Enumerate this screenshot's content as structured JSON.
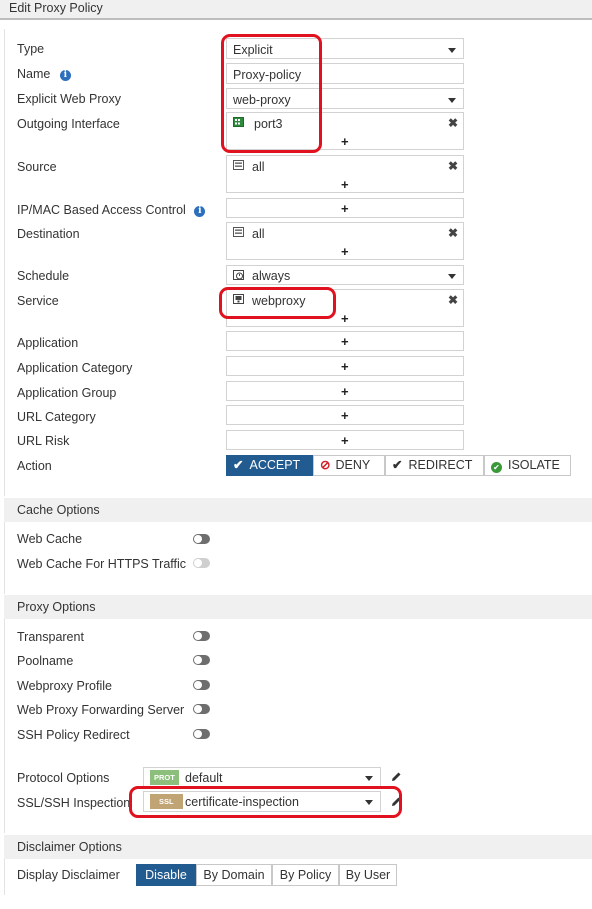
{
  "window": {
    "title": "Edit Proxy Policy"
  },
  "fields": {
    "type": {
      "label": "Type",
      "value": "Explicit"
    },
    "name": {
      "label": "Name",
      "value": "Proxy-policy"
    },
    "explicit_web_proxy": {
      "label": "Explicit Web Proxy",
      "value": "web-proxy"
    },
    "outgoing_interface": {
      "label": "Outgoing Interface",
      "value": "port3"
    },
    "source": {
      "label": "Source",
      "value": "all"
    },
    "ip_mac": {
      "label": "IP/MAC Based Access Control"
    },
    "destination": {
      "label": "Destination",
      "value": "all"
    },
    "schedule": {
      "label": "Schedule",
      "value": "always"
    },
    "service": {
      "label": "Service",
      "value": "webproxy"
    },
    "application": {
      "label": "Application"
    },
    "application_category": {
      "label": "Application Category"
    },
    "application_group": {
      "label": "Application Group"
    },
    "url_category": {
      "label": "URL Category"
    },
    "url_risk": {
      "label": "URL Risk"
    },
    "action": {
      "label": "Action",
      "options": [
        "ACCEPT",
        "DENY",
        "REDIRECT",
        "ISOLATE"
      ],
      "selected": "ACCEPT"
    }
  },
  "cache_options": {
    "header": "Cache Options",
    "web_cache": "Web Cache",
    "web_cache_https": "Web Cache For HTTPS Traffic"
  },
  "proxy_options": {
    "header": "Proxy Options",
    "transparent": "Transparent",
    "poolname": "Poolname",
    "webproxy_profile": "Webproxy Profile",
    "forwarding_server": "Web Proxy Forwarding Server",
    "ssh_redirect": "SSH Policy Redirect",
    "protocol_options": {
      "label": "Protocol Options",
      "badge": "PROT",
      "value": "default"
    },
    "ssl_ssh": {
      "label": "SSL/SSH Inspection",
      "badge": "SSL",
      "value": "certificate-inspection"
    }
  },
  "disclaimer": {
    "header": "Disclaimer Options",
    "label": "Display Disclaimer",
    "options": [
      "Disable",
      "By Domain",
      "By Policy",
      "By User"
    ],
    "selected": "Disable"
  },
  "icons": {
    "plus": "+",
    "remove": "✖"
  },
  "colors": {
    "accent": "#225b8f",
    "annotation": "#e0121f",
    "info": "#2c6fbd",
    "prot_badge": "#8dbf7c",
    "ssl_badge": "#c0a474"
  }
}
